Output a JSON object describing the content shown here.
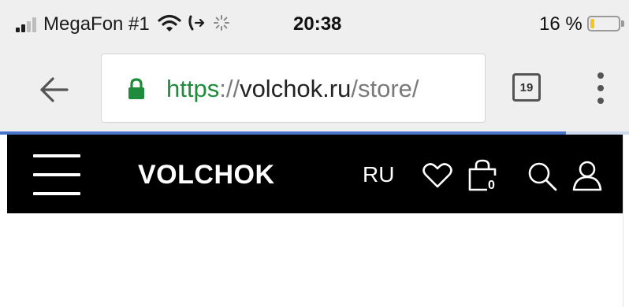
{
  "status_bar": {
    "carrier": "MegaFon #1",
    "time": "20:38",
    "battery_percent": "16 %",
    "battery_level": 0.16,
    "signal_bars_filled": 2,
    "signal_bars_total": 4,
    "icons": [
      "signal-icon",
      "wifi-icon",
      "call-forward-icon",
      "activity-spinner-icon",
      "battery-icon"
    ]
  },
  "browser": {
    "url_scheme": "https",
    "url_separator": "://",
    "url_host": "volchok.ru",
    "url_path": "/store/",
    "tab_count": "19",
    "load_progress": 0.9,
    "icons": [
      "back-arrow-icon",
      "lock-icon",
      "overflow-menu-icon"
    ]
  },
  "site_header": {
    "brand": "VOLCHOK",
    "language": "RU",
    "cart_count": "0",
    "icons": [
      "hamburger-menu-icon",
      "heart-icon",
      "bag-icon",
      "search-icon",
      "user-icon"
    ]
  },
  "colors": {
    "status_bg": "#efefef",
    "secure_green": "#1f8c3b",
    "progress_blue": "#4a73cc",
    "header_bg": "#000000",
    "battery_yellow": "#f5c518"
  }
}
